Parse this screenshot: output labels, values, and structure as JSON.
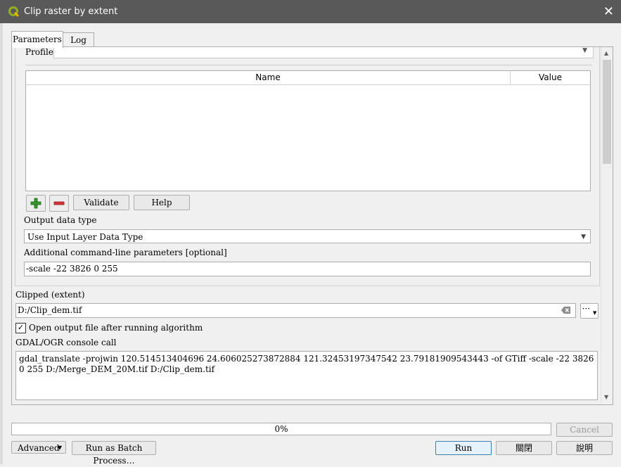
{
  "window": {
    "title": "Clip raster by extent",
    "close_glyph": "✕"
  },
  "tabs": [
    {
      "label": "Parameters"
    },
    {
      "label": "Log"
    }
  ],
  "profile": {
    "label": "Profile",
    "value": ""
  },
  "table": {
    "col_name": "Name",
    "col_value": "Value"
  },
  "table_buttons": {
    "validate": "Validate",
    "help": "Help"
  },
  "output_type": {
    "label": "Output data type",
    "value": "Use Input Layer Data Type"
  },
  "extra_params": {
    "label": "Additional command-line parameters [optional]",
    "value": "-scale -22 3826 0 255"
  },
  "clipped": {
    "label": "Clipped (extent)",
    "value": "D:/Clip_dem.tif",
    "browse": "···"
  },
  "open_output": {
    "label": "Open output file after running algorithm",
    "checked": true,
    "check": "✓"
  },
  "console": {
    "label": "GDAL/OGR console call",
    "value": "gdal_translate -projwin 120.514513404696 24.606025273872884 121.32453197347542 23.79181909543443 -of GTiff -scale -22 3826 0 255 D:/Merge_DEM_20M.tif D:/Clip_dem.tif"
  },
  "progress": {
    "text": "0%",
    "value": 0
  },
  "footer": {
    "cancel": "Cancel",
    "advanced": "Advanced",
    "batch": "Run as Batch Process…",
    "run": "Run",
    "close": "關閉",
    "help": "說明"
  },
  "colors": {
    "titlebar": "#595959",
    "add": "#3a9a2e",
    "remove": "#d9343a"
  }
}
